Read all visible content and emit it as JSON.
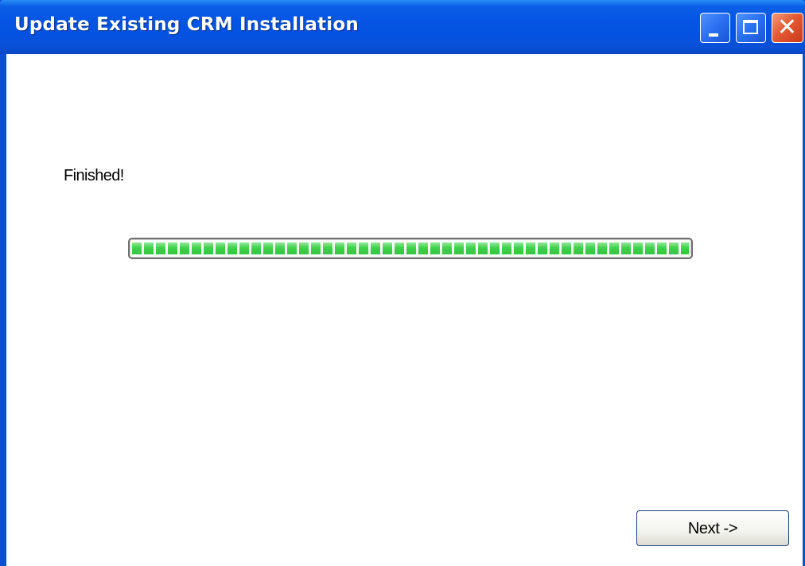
{
  "window": {
    "title": "Update Existing CRM Installation",
    "controls": {
      "minimize_icon": "minimize-icon",
      "maximize_icon": "maximize-icon",
      "close_icon": "close-icon",
      "close_glyph": "✕"
    }
  },
  "main": {
    "status_text": "Finished!",
    "progress_fraction": 1.0,
    "next_button_label": "Next ->"
  },
  "colors": {
    "titlebar": "#0554e3",
    "progress_green": "#3ed24a",
    "close_button": "#e45a32"
  }
}
